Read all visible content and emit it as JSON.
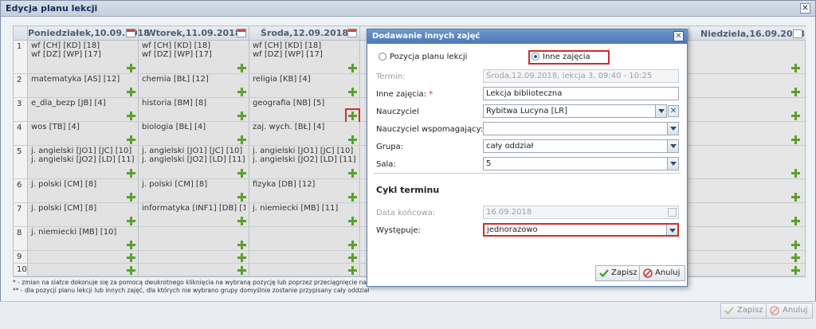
{
  "outer": {
    "title": "Edycja planu lekcji"
  },
  "grid": {
    "days": [
      "Poniedziałek,10.09.2018",
      "Wtorek,11.09.2018",
      "Środa,12.09.2018",
      "",
      "",
      "",
      "Niedziela,16.09.2018"
    ],
    "rows": [
      {
        "num": "1",
        "cells": [
          [
            "wf [CH] [KD] [18]",
            "wf [DZ] [WP] [17]"
          ],
          [
            "wf [CH] [KD] [18]",
            "wf [DZ] [WP] [17]"
          ],
          [
            "wf [CH] [KD] [18]",
            "wf [DZ] [WP] [17]"
          ]
        ]
      },
      {
        "num": "2",
        "cells": [
          [
            "matematyka [AS] [12]"
          ],
          [
            "chemia [BŁ] [12]"
          ],
          [
            "religia [KB] [4]"
          ]
        ]
      },
      {
        "num": "3",
        "cells": [
          [
            "e_dla_bezp [JB] [4]"
          ],
          [
            "historia [BM] [8]"
          ],
          [
            "geografia [NB] [5]"
          ]
        ]
      },
      {
        "num": "4",
        "cells": [
          [
            "wos [TB] [4]"
          ],
          [
            "biologia [BŁ] [4]"
          ],
          [
            "zaj. wych. [BŁ] [4]"
          ]
        ]
      },
      {
        "num": "5",
        "cells": [
          [
            "j. angielski [JO1] [JC] [10]",
            "j. angielski [JO2] [LD] [11]"
          ],
          [
            "j. angielski [JO1] [JC] [10]",
            "j. angielski [JO2] [LD] [11]"
          ],
          [
            "j. angielski [JO1] [JC] [10]",
            "j. angielski [JO2] [LD] [11]"
          ]
        ]
      },
      {
        "num": "6",
        "cells": [
          [
            "j. polski [CM] [8]"
          ],
          [
            "j. polski [CM] [8]"
          ],
          [
            "fizyka [DB] [12]"
          ]
        ]
      },
      {
        "num": "7",
        "cells": [
          [
            "j. polski [CM] [8]"
          ],
          [
            "informatyka [INF1] [DB] [15]"
          ],
          [
            "j. niemiecki [MB] [11]"
          ]
        ]
      },
      {
        "num": "8",
        "cells": [
          [
            "j. niemiecki [MB] [10]"
          ],
          [],
          []
        ]
      },
      {
        "num": "9",
        "cells": [
          [],
          [],
          []
        ]
      },
      {
        "num": "10",
        "cells": [
          [],
          [],
          []
        ]
      }
    ]
  },
  "notes": {
    "line1": "* - zmian na siatce dokonuje się za pomocą dwukrotnego kliknięcia na wybraną pozycję lub poprzez przeciągnięcie na siatkę wybranej poz",
    "line2": "** - dla pozycji planu lekcji lub innych zajęć, dla których nie wybrano grupy domyślnie zostanie przypisany cały oddział"
  },
  "bottom": {
    "save_label": "Zapisz",
    "cancel_label": "Anuluj"
  },
  "modal": {
    "title": "Dodawanie innych zajęć",
    "radio_option1": "Pozycja planu lekcji",
    "radio_option2": "Inne zajęcia",
    "termin_label": "Termin:",
    "termin_value": "Środa,12.09.2018, lekcja 3, 09:40 - 10:25",
    "inne_label": "Inne zajęcia:",
    "required_mark": "*",
    "inne_value": "Lekcja biblioteczna",
    "nauczyciel_label": "Nauczyciel",
    "nauczyciel_value": "Rybitwa Lucyna [LR]",
    "wspom_label": "Nauczyciel wspomagający:",
    "wspom_value": "",
    "grupa_label": "Grupa:",
    "grupa_value": "cały oddział",
    "sala_label": "Sala:",
    "sala_value": "5",
    "cycle_title": "Cykl terminu",
    "data_label": "Data końcowa:",
    "data_value": "16.09.2018",
    "wyst_label": "Występuje:",
    "wyst_value": "jednorazowo",
    "save_label": "Zapisz",
    "cancel_label": "Anuluj"
  },
  "colors": {
    "accent": "#4b78b6",
    "highlight": "#d62a2a",
    "plus": "#5aa02c"
  }
}
